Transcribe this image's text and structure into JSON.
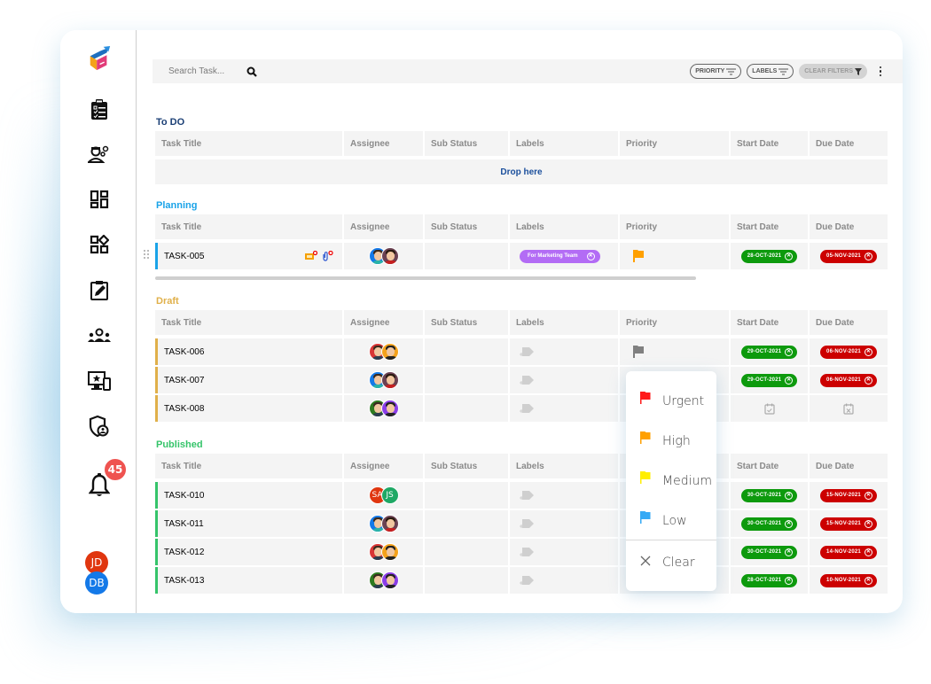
{
  "search": {
    "placeholder": "Search Task..."
  },
  "filters": {
    "priority": "PRIORITY",
    "labels": "LABELS",
    "clear": "CLEAR FILTERS"
  },
  "sidebar": {
    "items": [
      {
        "icon": "app-logo-icon"
      },
      {
        "icon": "clipboard-list-icon"
      },
      {
        "icon": "user-settings-icon"
      },
      {
        "icon": "dashboard-icon"
      },
      {
        "icon": "widgets-icon"
      },
      {
        "icon": "edit-clipboard-icon"
      },
      {
        "icon": "team-icon"
      },
      {
        "icon": "devices-icon"
      },
      {
        "icon": "shield-user-icon"
      },
      {
        "icon": "bell-icon"
      }
    ],
    "notification_count": "45",
    "users": [
      {
        "initials": "JD",
        "color": "#e0360f"
      },
      {
        "initials": "DB",
        "color": "#1479e8"
      }
    ]
  },
  "columns": [
    "Task Title",
    "Assignee",
    "Sub Status",
    "Labels",
    "Priority",
    "Start Date",
    "Due Date"
  ],
  "sections": {
    "todo": {
      "title": "To DO",
      "color": "#1b3f75",
      "drop_text": "Drop here"
    },
    "planning": {
      "title": "Planning",
      "color": "#1aa3e8",
      "tasks": [
        {
          "id": "TASK-005",
          "label": "For Marketing Team",
          "priority": "High",
          "priority_color": "#ffa000",
          "start": "28-OCT-2021",
          "due": "05-NOV-2021"
        }
      ]
    },
    "draft": {
      "title": "Draft",
      "color": "#e0b04a",
      "tasks": [
        {
          "id": "TASK-006",
          "priority_color": "#808080",
          "start": "29-OCT-2021",
          "due": "06-NOV-2021"
        },
        {
          "id": "TASK-007",
          "start": "29-OCT-2021",
          "due": "06-NOV-2021"
        },
        {
          "id": "TASK-008"
        }
      ]
    },
    "published": {
      "title": "Published",
      "color": "#35c46a",
      "tasks": [
        {
          "id": "TASK-010",
          "assignees": [
            "SA",
            "JS"
          ],
          "start": "30-OCT-2021",
          "due": "15-NOV-2021"
        },
        {
          "id": "TASK-011",
          "start": "30-OCT-2021",
          "due": "15-NOV-2021"
        },
        {
          "id": "TASK-012",
          "start": "30-OCT-2021",
          "due": "14-NOV-2021"
        },
        {
          "id": "TASK-013",
          "start": "28-OCT-2021",
          "due": "10-NOV-2021"
        }
      ]
    }
  },
  "priority_menu": {
    "items": [
      {
        "label": "Urgent",
        "color": "#ff1a1a"
      },
      {
        "label": "High",
        "color": "#ffa000"
      },
      {
        "label": "Medium",
        "color": "#ffee00"
      },
      {
        "label": "Low",
        "color": "#36aaf5"
      }
    ],
    "clear": "Clear"
  }
}
